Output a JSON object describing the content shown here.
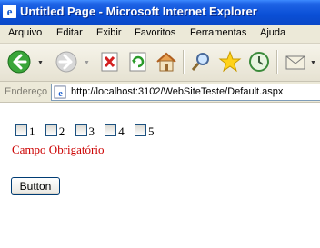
{
  "window": {
    "title": "Untitled Page - Microsoft Internet Explorer"
  },
  "menu": [
    "Arquivo",
    "Editar",
    "Exibir",
    "Favoritos",
    "Ferramentas",
    "Ajuda"
  ],
  "toolbar": {
    "icons": [
      "back-icon",
      "forward-icon",
      "stop-icon",
      "refresh-icon",
      "home-icon",
      "search-icon",
      "favorites-icon",
      "history-icon",
      "mail-icon"
    ]
  },
  "address": {
    "label": "Endereço",
    "url": "http://localhost:3102/WebSiteTeste/Default.aspx"
  },
  "page": {
    "checkboxes": [
      {
        "label": "1",
        "checked": false
      },
      {
        "label": "2",
        "checked": false
      },
      {
        "label": "3",
        "checked": false
      },
      {
        "label": "4",
        "checked": false
      },
      {
        "label": "5",
        "checked": false
      }
    ],
    "validation_message": "Campo Obrigatório",
    "button_label": "Button"
  },
  "colors": {
    "titlebar": "#0a4fd6",
    "error_text": "#cc0000"
  }
}
